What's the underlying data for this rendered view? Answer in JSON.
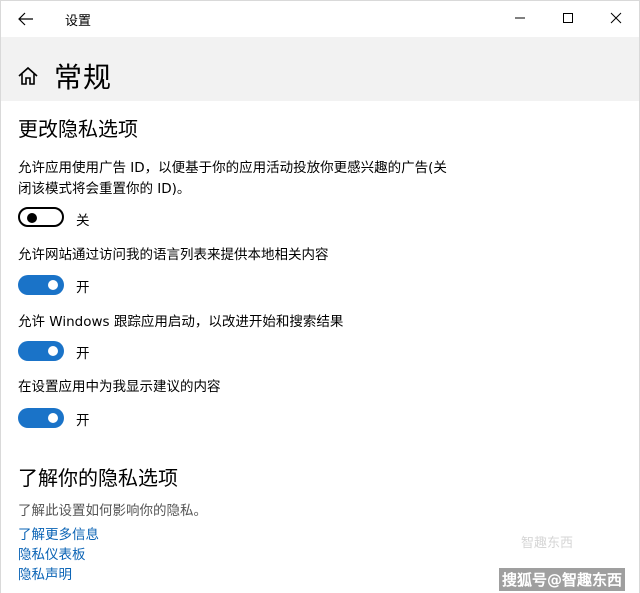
{
  "window": {
    "title": "设置"
  },
  "header": {
    "title": "常规"
  },
  "privacy_options": {
    "heading": "更改隐私选项",
    "items": [
      {
        "label_line1": "允许应用使用广告 ID，以便基于你的应用活动投放你更感兴趣的广告(关",
        "label_line2": "闭该模式将会重置你的 ID)。",
        "state": "关",
        "on": false
      },
      {
        "label_line1": "允许网站通过访问我的语言列表来提供本地相关内容",
        "state": "开",
        "on": true
      },
      {
        "label_line1": "允许 Windows 跟踪应用启动，以改进开始和搜索结果",
        "state": "开",
        "on": true
      },
      {
        "label_line1": "在设置应用中为我显示建议的内容",
        "state": "开",
        "on": true
      }
    ]
  },
  "learn_more": {
    "heading": "了解你的隐私选项",
    "description": "了解此设置如何影响你的隐私。",
    "links": [
      "了解更多信息",
      "隐私仪表板",
      "隐私声明"
    ]
  },
  "watermark": {
    "logo_text": "智趣东西",
    "text": "搜狐号@智趣东西"
  },
  "colors": {
    "accent": "#1a73c8",
    "link": "#0a63b5",
    "header_bg": "#f2f2f2"
  },
  "icons": [
    "back-arrow-icon",
    "minimize-icon",
    "maximize-icon",
    "close-icon",
    "home-icon"
  ]
}
